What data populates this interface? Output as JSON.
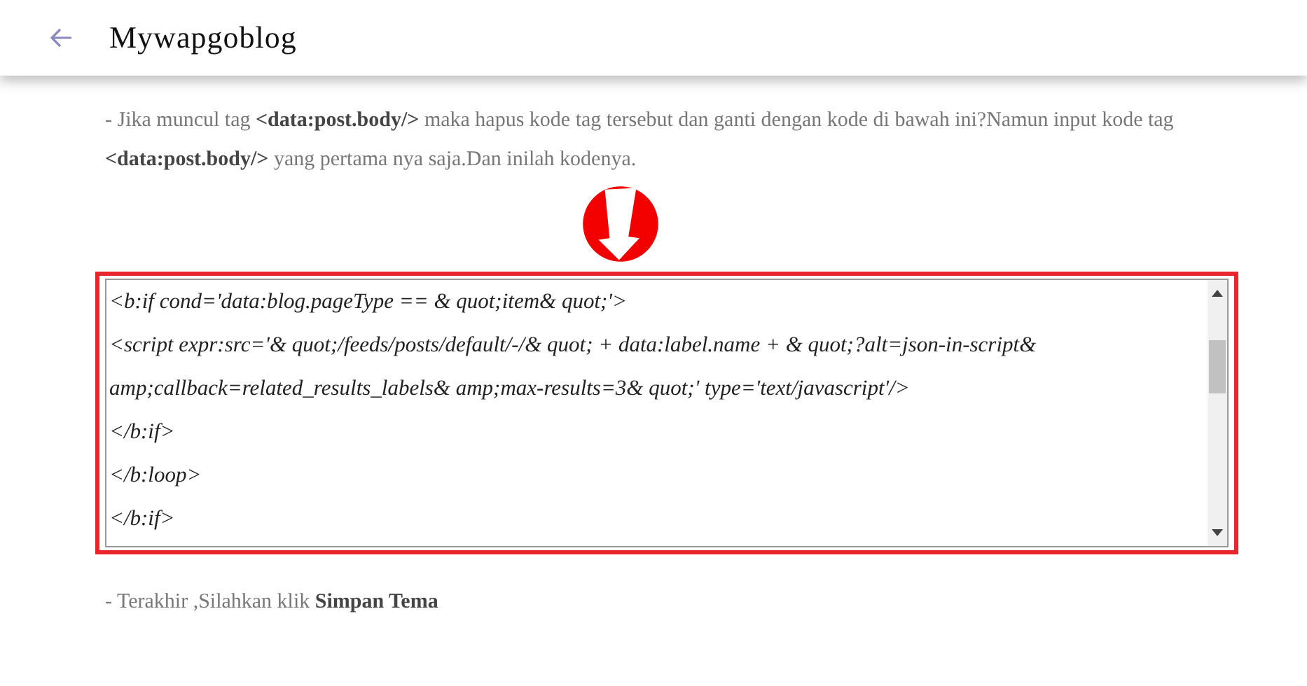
{
  "header": {
    "title": "Mywapgoblog"
  },
  "intro": "- Jika muncul tag **<data:post.body/>** maka hapus kode tag tersebut dan ganti dengan kode di bawah ini?Namun input kode tag **<data:post.body/>** yang pertama nya saja.Dan inilah kodenya.",
  "code_lines": [
    "<b:if cond='data:blog.pageType == & quot;item& quot;'>",
    "<script expr:src='& quot;/feeds/posts/default/-/& quot; + data:label.name + & quot;?alt=json-in-script& amp;callback=related_results_labels& amp;max-results=3& quot;' type='text/javascript'/>",
    "</b:if>",
    "</b:loop>",
    "</b:if>"
  ],
  "outro": "- Terakhir ,Silahkan klik **Simpan Tema**"
}
